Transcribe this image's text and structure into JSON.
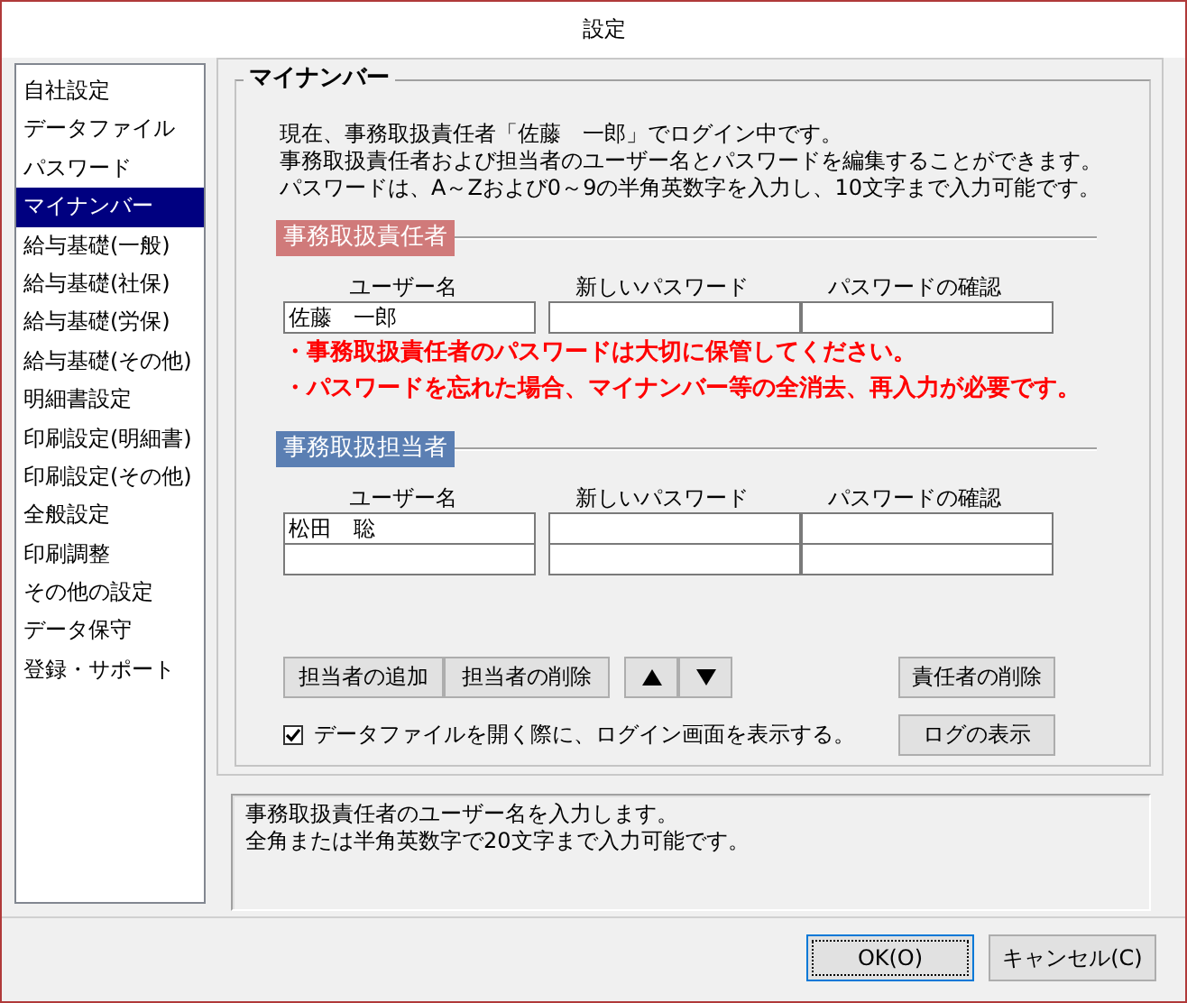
{
  "window": {
    "title": "設定"
  },
  "sidebar": {
    "items": [
      {
        "label": "自社設定",
        "selected": false
      },
      {
        "label": "データファイル",
        "selected": false
      },
      {
        "label": "パスワード",
        "selected": false
      },
      {
        "label": "マイナンバー",
        "selected": true
      },
      {
        "label": "給与基礎(一般)",
        "selected": false
      },
      {
        "label": "給与基礎(社保)",
        "selected": false
      },
      {
        "label": "給与基礎(労保)",
        "selected": false
      },
      {
        "label": "給与基礎(その他)",
        "selected": false
      },
      {
        "label": "明細書設定",
        "selected": false
      },
      {
        "label": "印刷設定(明細書)",
        "selected": false
      },
      {
        "label": "印刷設定(その他)",
        "selected": false
      },
      {
        "label": "全般設定",
        "selected": false
      },
      {
        "label": "印刷調整",
        "selected": false
      },
      {
        "label": "その他の設定",
        "selected": false
      },
      {
        "label": "データ保守",
        "selected": false
      },
      {
        "label": "登録・サポート",
        "selected": false
      }
    ]
  },
  "panel": {
    "title": "マイナンバー",
    "description": [
      "現在、事務取扱責任者「佐藤　一郎」でログイン中です。",
      "事務取扱責任者および担当者のユーザー名とパスワードを編集することができます。",
      "パスワードは、A～Zおよび0～9の半角英数字を入力し、10文字まで入力可能です。"
    ],
    "sections": [
      {
        "heading": "事務取扱責任者",
        "color": "#d07a7a",
        "columns": [
          "ユーザー名",
          "新しいパスワード",
          "パスワードの確認"
        ],
        "rows": [
          {
            "user_name": "佐藤　一郎"
          }
        ],
        "warnings": [
          "・事務取扱責任者のパスワードは大切に保管してください。",
          "・パスワードを忘れた場合、マイナンバー等の全消去、再入力が必要です。"
        ]
      },
      {
        "heading": "事務取扱担当者",
        "color": "#5b7fb3",
        "columns": [
          "ユーザー名",
          "新しいパスワード",
          "パスワードの確認"
        ],
        "rows": [
          {
            "user_name": "松田　聡"
          },
          {}
        ]
      }
    ],
    "actions": [
      {
        "kind": "text",
        "label": "担当者の追加"
      },
      {
        "kind": "text",
        "label": "担当者の削除"
      },
      {
        "kind": "up"
      },
      {
        "kind": "down"
      }
    ],
    "remove_manager_button": "責任者の削除",
    "checkbox": {
      "label": "データファイルを開く際に、ログイン画面を表示する。",
      "checked": true
    },
    "log_button": "ログの表示"
  },
  "help": [
    "事務取扱責任者のユーザー名を入力します。",
    "全角または半角英数字で20文字まで入力可能です。"
  ],
  "footer": {
    "buttons": [
      {
        "label": "OK(O)",
        "focused": true
      },
      {
        "label": "キャンセル(C)",
        "focused": false
      }
    ]
  }
}
